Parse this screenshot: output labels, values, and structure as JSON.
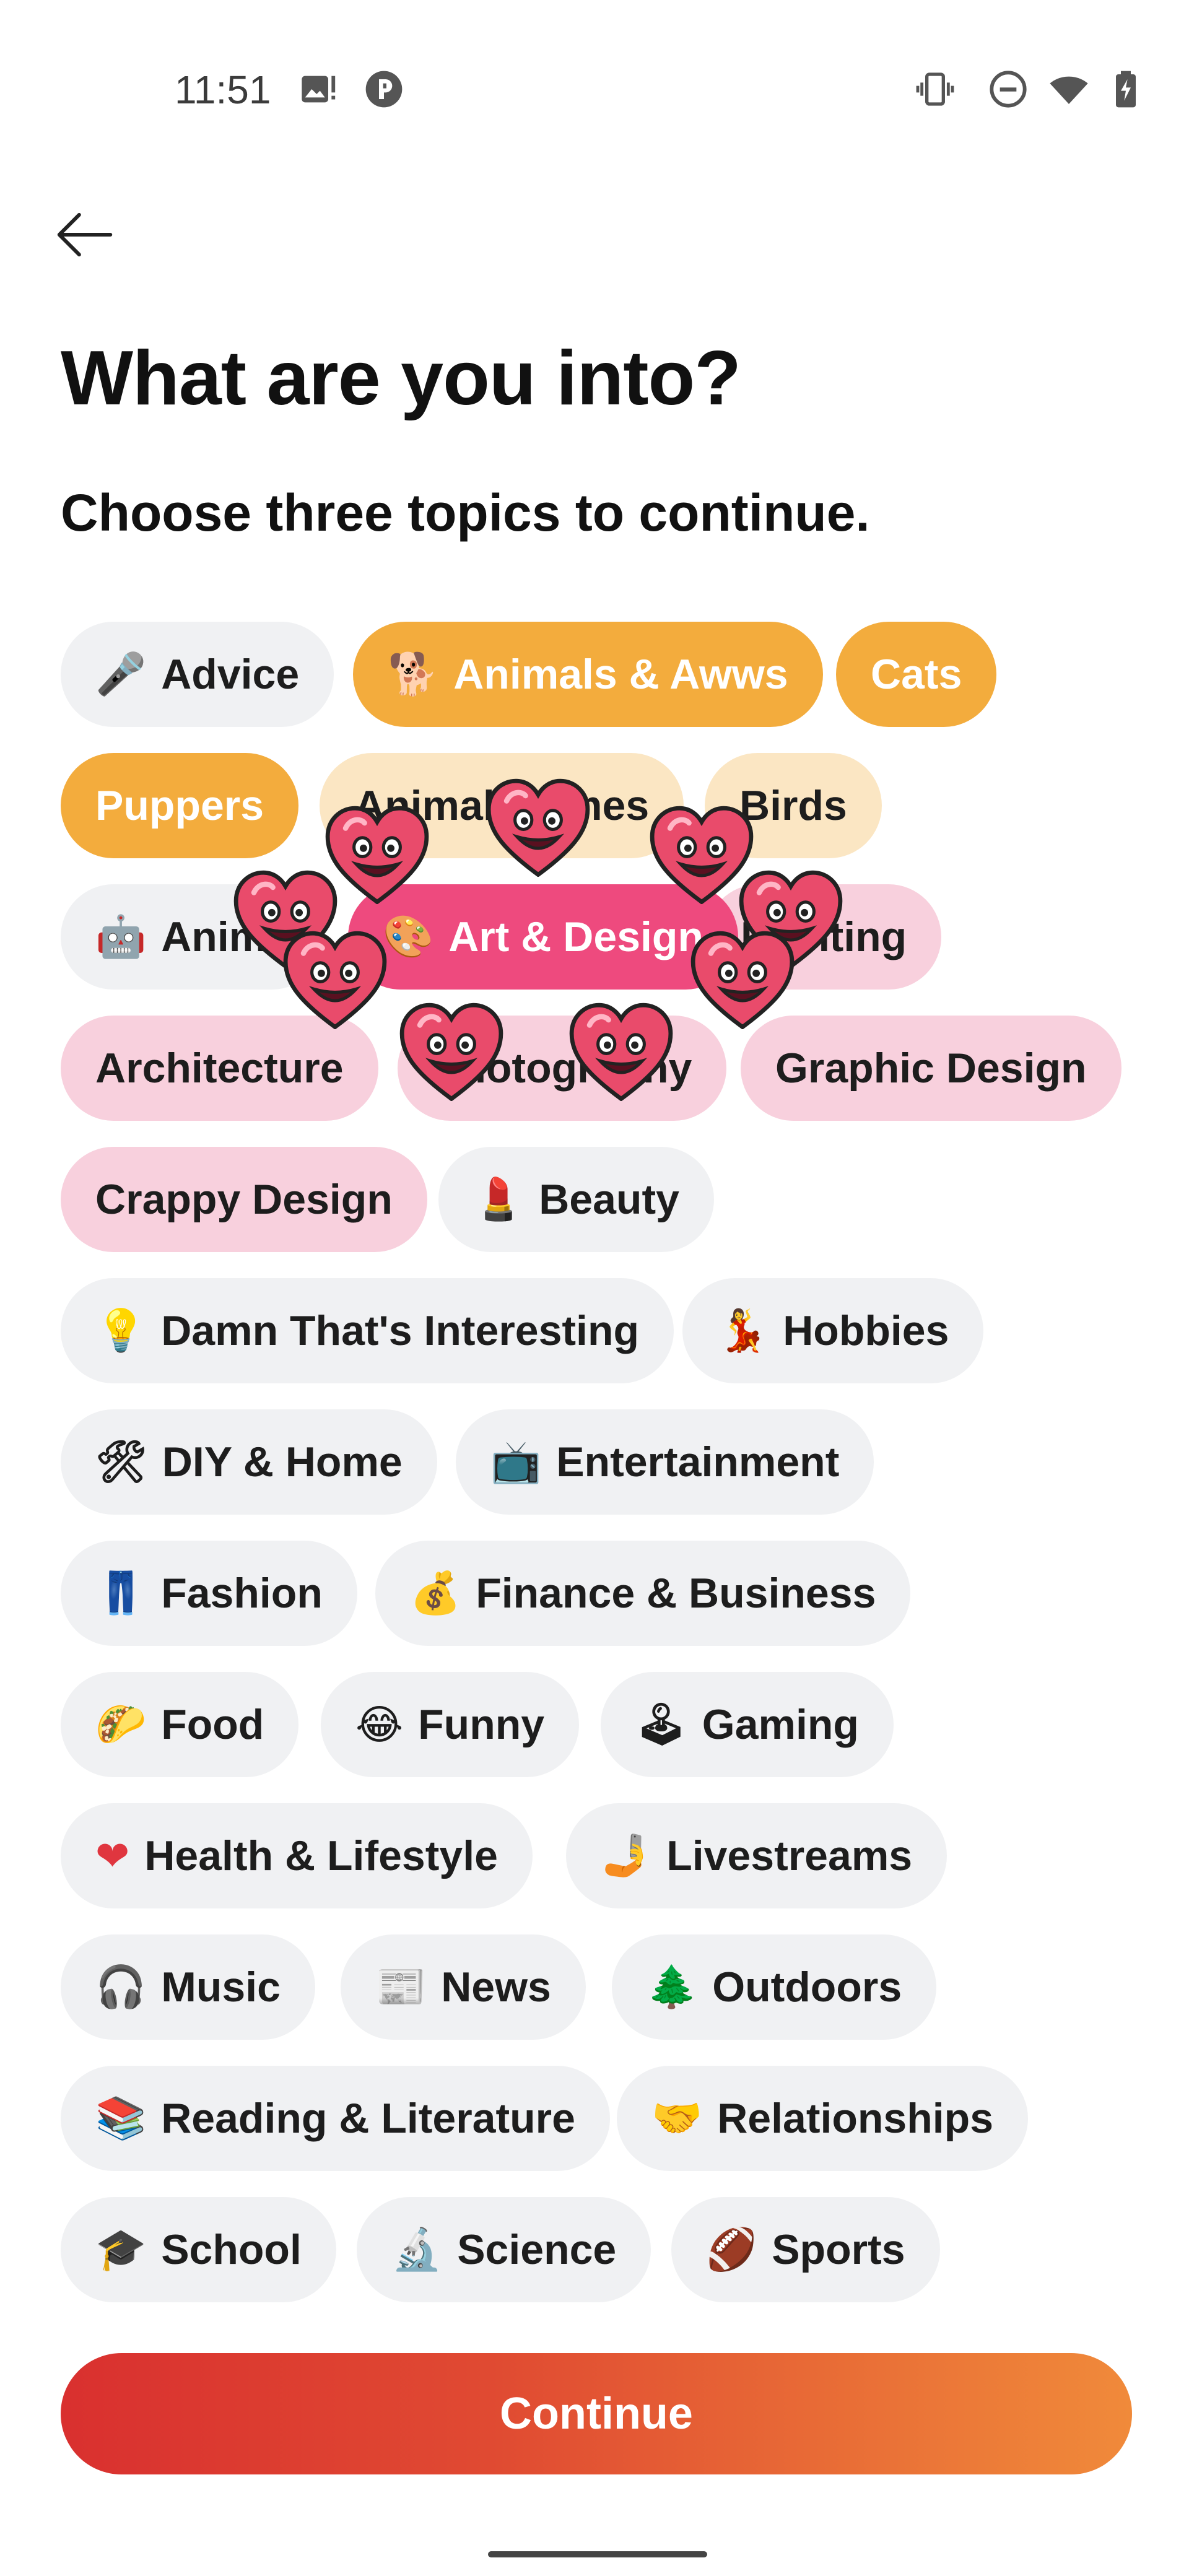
{
  "status_bar": {
    "time": "11:51",
    "left_icons": [
      "image-notification-icon",
      "app-notification-icon"
    ],
    "right_icons": [
      "vibrate-icon",
      "do-not-disturb-icon",
      "wifi-icon",
      "battery-charging-icon"
    ]
  },
  "header": {
    "back_icon": "arrow-left-icon",
    "title": "What are you into?",
    "subtitle": "Choose three topics to continue."
  },
  "topics": [
    {
      "emoji": "🎤",
      "label": "Advice",
      "state": "default"
    },
    {
      "emoji": "🐕",
      "label": "Animals & Awws",
      "state": "selected-orange"
    },
    {
      "emoji": "",
      "label": "Cats",
      "state": "selected-orange"
    },
    {
      "emoji": "",
      "label": "Puppers",
      "state": "selected-orange"
    },
    {
      "emoji": "",
      "label": "Animal Memes",
      "state": "subtopic-orange"
    },
    {
      "emoji": "",
      "label": "Birds",
      "state": "subtopic-orange"
    },
    {
      "emoji": "🤖",
      "label": "Anime",
      "state": "default"
    },
    {
      "emoji": "🎨",
      "label": "Art & Design",
      "state": "selected-pink"
    },
    {
      "emoji": "",
      "label": "Painting",
      "state": "subtopic-pink"
    },
    {
      "emoji": "",
      "label": "Architecture",
      "state": "subtopic-pink"
    },
    {
      "emoji": "",
      "label": "Photography",
      "state": "subtopic-pink"
    },
    {
      "emoji": "",
      "label": "Graphic Design",
      "state": "subtopic-pink"
    },
    {
      "emoji": "",
      "label": "Crappy Design",
      "state": "subtopic-pink"
    },
    {
      "emoji": "💄",
      "label": "Beauty",
      "state": "default"
    },
    {
      "emoji": "💡",
      "label": "Damn That's Interesting",
      "state": "default"
    },
    {
      "emoji": "💃",
      "label": "Hobbies",
      "state": "default"
    },
    {
      "emoji": "🛠",
      "label": "DIY & Home",
      "state": "default"
    },
    {
      "emoji": "📺",
      "label": "Entertainment",
      "state": "default"
    },
    {
      "emoji": "👖",
      "label": "Fashion",
      "state": "default"
    },
    {
      "emoji": "💰",
      "label": "Finance & Business",
      "state": "default"
    },
    {
      "emoji": "🌮",
      "label": "Food",
      "state": "default"
    },
    {
      "emoji": "😂",
      "label": "Funny",
      "state": "default"
    },
    {
      "emoji": "🕹",
      "label": "Gaming",
      "state": "default"
    },
    {
      "emoji": "❤",
      "label": "Health & Lifestyle",
      "state": "default"
    },
    {
      "emoji": "🤳",
      "label": "Livestreams",
      "state": "default"
    },
    {
      "emoji": "🎧",
      "label": "Music",
      "state": "default"
    },
    {
      "emoji": "📰",
      "label": "News",
      "state": "default"
    },
    {
      "emoji": "🌲",
      "label": "Outdoors",
      "state": "default"
    },
    {
      "emoji": "📚",
      "label": "Reading & Literature",
      "state": "default"
    },
    {
      "emoji": "🤝",
      "label": "Relationships",
      "state": "default"
    },
    {
      "emoji": "🎓",
      "label": "School",
      "state": "default"
    },
    {
      "emoji": "🔬",
      "label": "Science",
      "state": "default"
    },
    {
      "emoji": "🏈",
      "label": "Sports",
      "state": "default"
    }
  ],
  "overlay": {
    "heart_icon": "smiling-heart-icon",
    "count": 9
  },
  "continue_label": "Continue",
  "colors": {
    "selected_orange": "#f3ac3d",
    "subtopic_orange": "#fbe6c3",
    "selected_pink": "#ee4a7e",
    "subtopic_pink": "#f8d0dd",
    "chip_default": "#f0f1f3",
    "continue_start": "#d9302f",
    "continue_end": "#f08a3a"
  }
}
